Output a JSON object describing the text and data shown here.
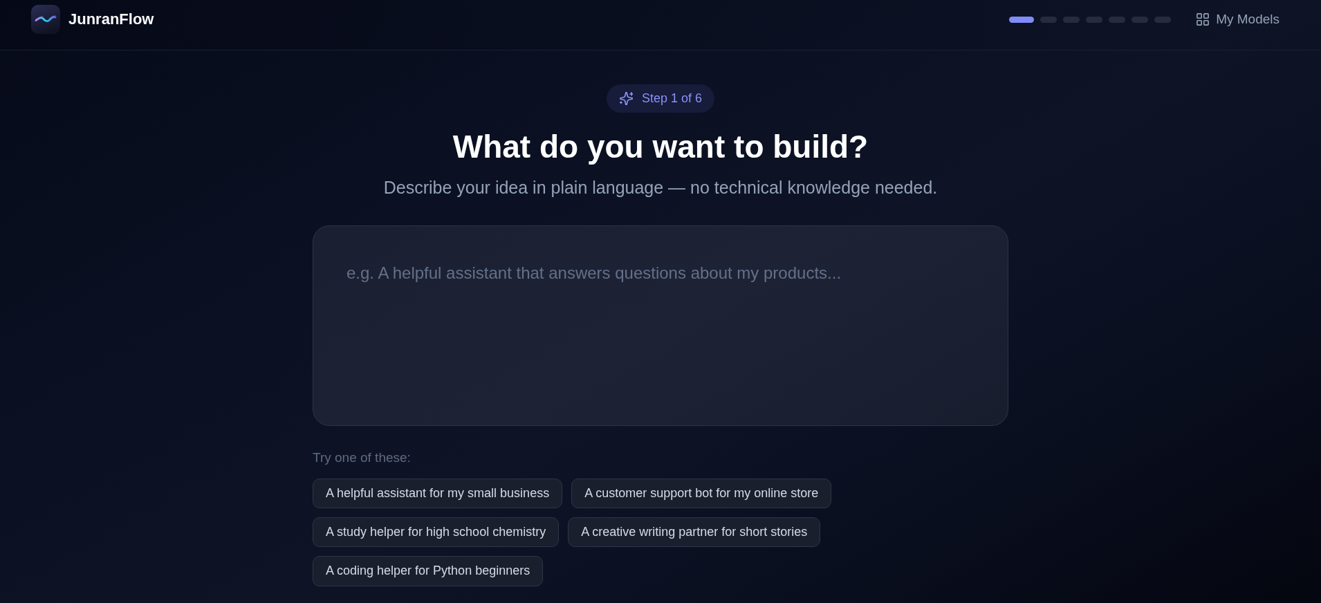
{
  "header": {
    "brand": "JunranFlow",
    "steps": [
      {
        "active": true
      },
      {
        "active": false
      },
      {
        "active": false
      },
      {
        "active": false
      },
      {
        "active": false
      },
      {
        "active": false
      },
      {
        "active": false
      }
    ],
    "nav_link": "My Models"
  },
  "step_badge": "Step 1 of 6",
  "title": "What do you want to build?",
  "subtitle": "Describe your idea in plain language — no technical knowledge needed.",
  "idea_input": {
    "placeholder": "e.g. A helpful assistant that answers questions about my products..."
  },
  "suggestions": {
    "label": "Try one of these:",
    "items": [
      "A helpful assistant for my small business",
      "A customer support bot for my online store",
      "A study helper for high school chemistry",
      "A creative writing partner for short stories",
      "A coding helper for Python beginners"
    ]
  }
}
